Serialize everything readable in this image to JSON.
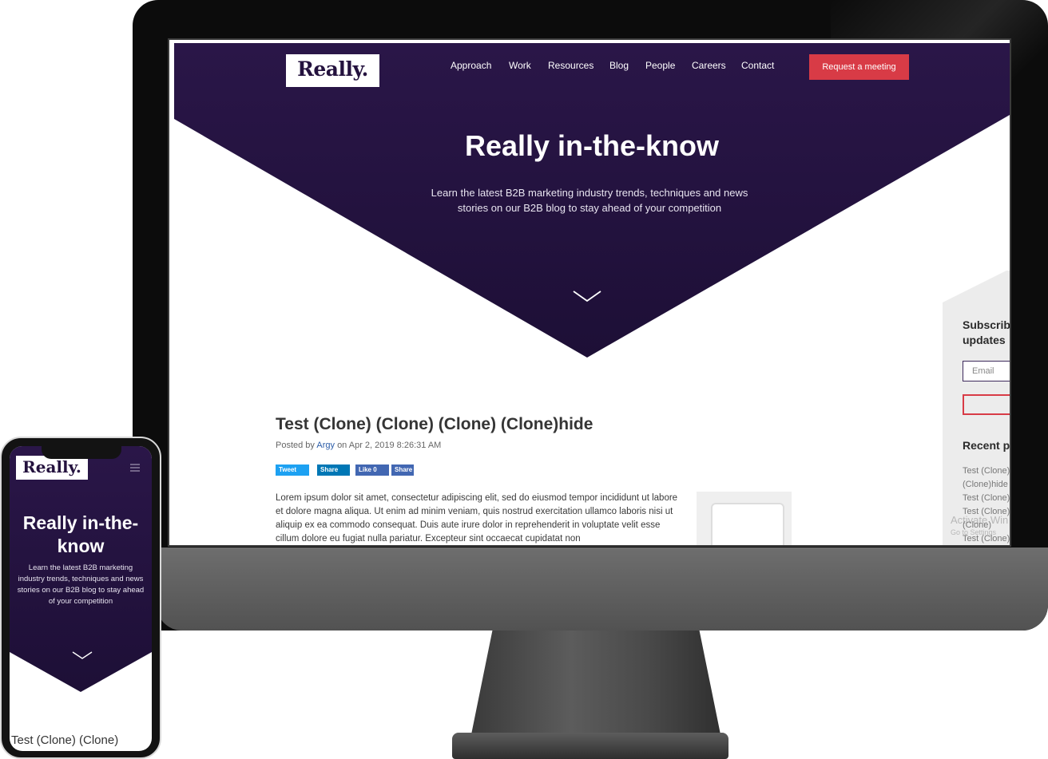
{
  "desktop": {
    "logo": "Really.",
    "nav": [
      "Approach",
      "Work",
      "Resources",
      "Blog",
      "People",
      "Careers",
      "Contact"
    ],
    "cta": "Request a meeting",
    "hero": {
      "title": "Really in-the-know",
      "subtitle": "Learn the latest B2B marketing industry trends, techniques and news stories on our B2B blog to stay ahead of your competition"
    },
    "post": {
      "title": "Test (Clone) (Clone) (Clone) (Clone)hide",
      "posted_prefix": "Posted by",
      "author": "Argy",
      "posted_suffix": "on Apr 2, 2019 8:26:31 AM",
      "share": [
        "Tweet",
        "Share",
        "Like 0",
        "Share"
      ],
      "body": "Lorem ipsum dolor sit amet, consectetur adipiscing elit, sed do eiusmod tempor incididunt ut labore et dolore magna aliqua. Ut enim ad minim veniam, quis nostrud exercitation ullamco laboris nisi ut aliquip ex ea commodo consequat. Duis aute irure dolor in reprehenderit in voluptate velit esse cillum dolore eu fugiat nulla pariatur. Excepteur sint occaecat cupidatat non"
    },
    "sidebar": {
      "subscribe_line1": "Subscrib",
      "subscribe_line2": "updates",
      "email_placeholder": "Email",
      "recent_title": "Recent p",
      "recent": [
        "Test (Clone)",
        "(Clone)hide",
        "Test (Clone)",
        "Test (Clone)",
        "(Clone)",
        "Test (Clone)"
      ],
      "watermark": "Activate Win",
      "watermark_sub": "Go to Settings"
    }
  },
  "mobile": {
    "logo": "Really.",
    "hero": {
      "title": "Really in-the-know",
      "subtitle": "Learn the latest B2B marketing industry trends, techniques and news stories on our B2B blog to stay ahead of your competition"
    },
    "post_title": "Test (Clone) (Clone)"
  },
  "colors": {
    "hero_purple": "#24123e",
    "cta_red": "#d83b46",
    "link_blue": "#2b5ca8"
  }
}
